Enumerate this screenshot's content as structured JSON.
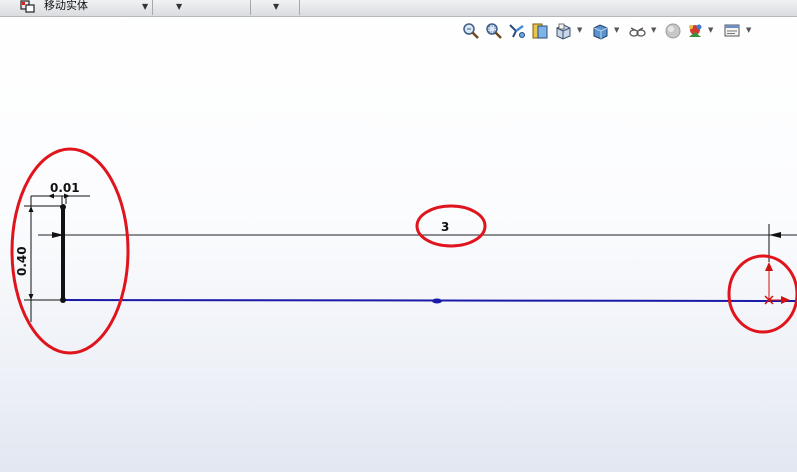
{
  "toolbar": {
    "move_entity_label": "移动实体"
  },
  "view_toolbar": {
    "icons": [
      "zoom-to-fit-icon",
      "zoom-to-area-icon",
      "previous-view-icon",
      "section-view-icon",
      "view-orientation-icon",
      "display-style-icon",
      "hide-show-items-icon",
      "edit-appearance-icon",
      "apply-scene-icon",
      "view-settings-icon"
    ]
  },
  "sketch": {
    "dimension_width": "0.01",
    "dimension_height": "0.40",
    "dimension_length": "3",
    "colors": {
      "sketch_line": "#1a1aa8",
      "dimension_line": "#111111",
      "annotation_circle": "#e0141c",
      "origin": "#d01010"
    }
  }
}
